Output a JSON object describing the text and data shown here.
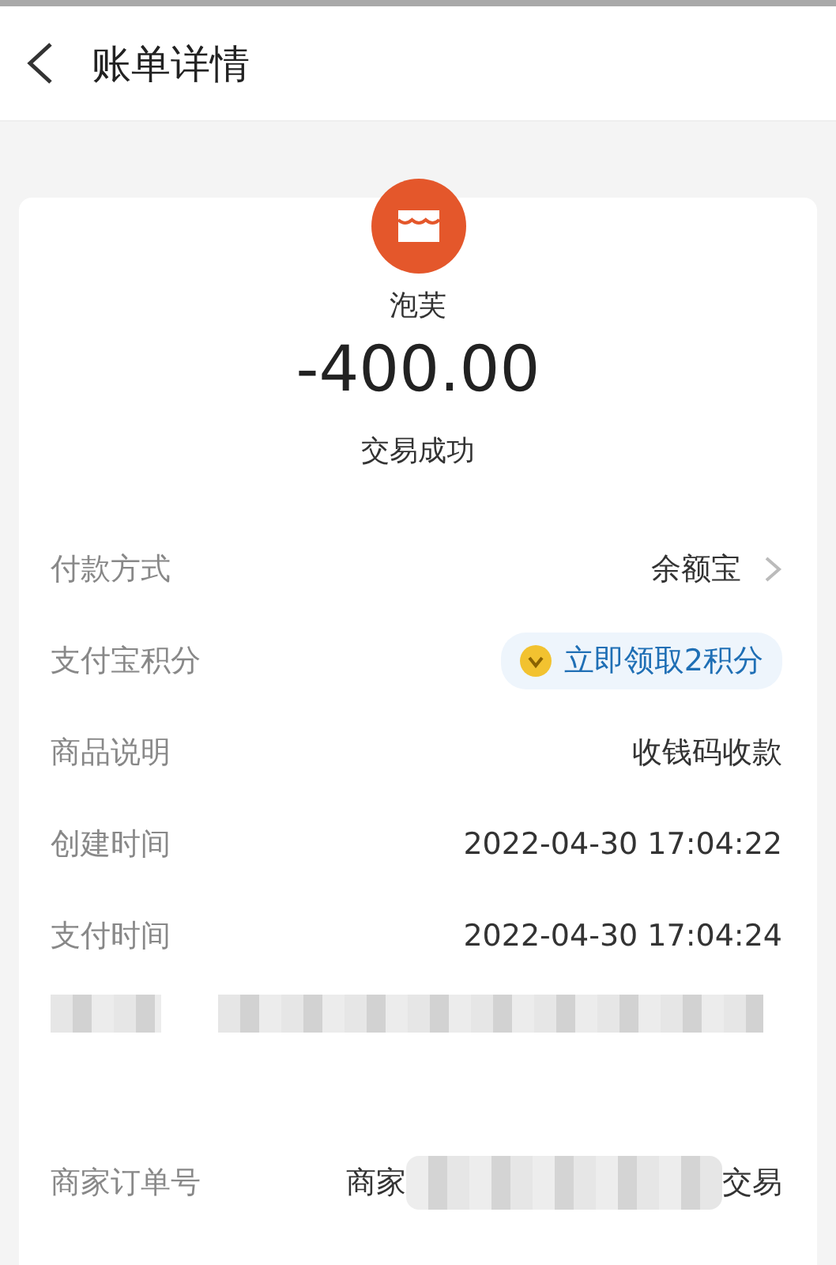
{
  "header": {
    "title": "账单详情"
  },
  "summary": {
    "merchant": "泡芙",
    "amount": "-400.00",
    "status": "交易成功"
  },
  "rows": [
    {
      "kind": "link",
      "label": "付款方式",
      "value": "余额宝"
    },
    {
      "kind": "points",
      "label": "支付宝积分",
      "value": "立即领取2积分"
    },
    {
      "kind": "text",
      "label": "商品说明",
      "value": "收钱码收款"
    },
    {
      "kind": "text",
      "label": "创建时间",
      "value": "2022-04-30 17:04:22"
    },
    {
      "kind": "text",
      "label": "支付时间",
      "value": "2022-04-30 17:04:24"
    },
    {
      "kind": "redacted"
    },
    {
      "kind": "partial",
      "label": "商家订单号",
      "value_start": "商家",
      "value_end": "交易"
    }
  ]
}
